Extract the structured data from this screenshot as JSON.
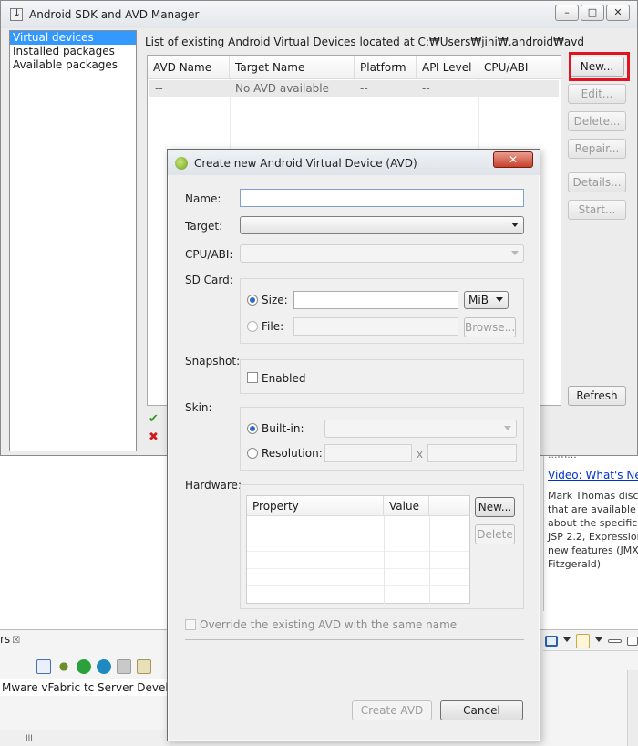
{
  "ide": {
    "right_panel": {
      "clipped_text": "...m...",
      "link": "Video: What's New",
      "blurb": "Mark Thomas disc\nthat are available i\nabout the specifica\nJSP 2.2, Expression\nnew features (JMX\nFitzgerald)"
    },
    "servers_tab": {
      "label": "rs",
      "close": "☒"
    },
    "server_row": "Mware vFabric tc Server Develope",
    "scroll_thumb": "III"
  },
  "sdk_manager": {
    "title": "Android SDK and AVD Manager",
    "window_buttons": [
      "–",
      "□",
      "✕"
    ],
    "nav": [
      "Virtual devices",
      "Installed packages",
      "Available packages"
    ],
    "info": "List of existing Android Virtual Devices located at C:₩Users₩jini₩.android₩avd",
    "table": {
      "headers": [
        "AVD Name",
        "Target Name",
        "Platform",
        "API Level",
        "CPU/ABI"
      ],
      "row": [
        "--",
        "No AVD available",
        "--",
        "--",
        ""
      ]
    },
    "buttons": {
      "new": "New...",
      "edit": "Edit...",
      "delete": "Delete...",
      "repair": "Repair...",
      "details": "Details...",
      "start": "Start...",
      "refresh": "Refresh"
    },
    "legend": {
      "valid": "✔",
      "invalid": "✖"
    }
  },
  "dialog": {
    "title": "Create new Android Virtual Device (AVD)",
    "close": "✕",
    "labels": {
      "name": "Name:",
      "target": "Target:",
      "cpu": "CPU/ABI:",
      "sdcard": "SD Card:",
      "snapshot": "Snapshot:",
      "skin": "Skin:",
      "hardware": "Hardware:"
    },
    "name_value": "",
    "sdcard": {
      "size_label": "Size:",
      "size_value": "",
      "unit": "MiB",
      "file_label": "File:",
      "browse": "Browse..."
    },
    "snapshot": {
      "enabled_label": "Enabled"
    },
    "skin": {
      "builtin_label": "Built-in:",
      "resolution_label": "Resolution:",
      "x": "x"
    },
    "hardware": {
      "headers": [
        "Property",
        "Value"
      ],
      "new": "New...",
      "delete": "Delete"
    },
    "override_label": "Override the existing AVD with the same name",
    "create": "Create AVD",
    "cancel": "Cancel"
  },
  "colors": {
    "selection": "#3399ff",
    "highlight": "#e0141e",
    "valid": "#2f9e1f",
    "invalid": "#d11a1a",
    "link": "#0033cc"
  }
}
